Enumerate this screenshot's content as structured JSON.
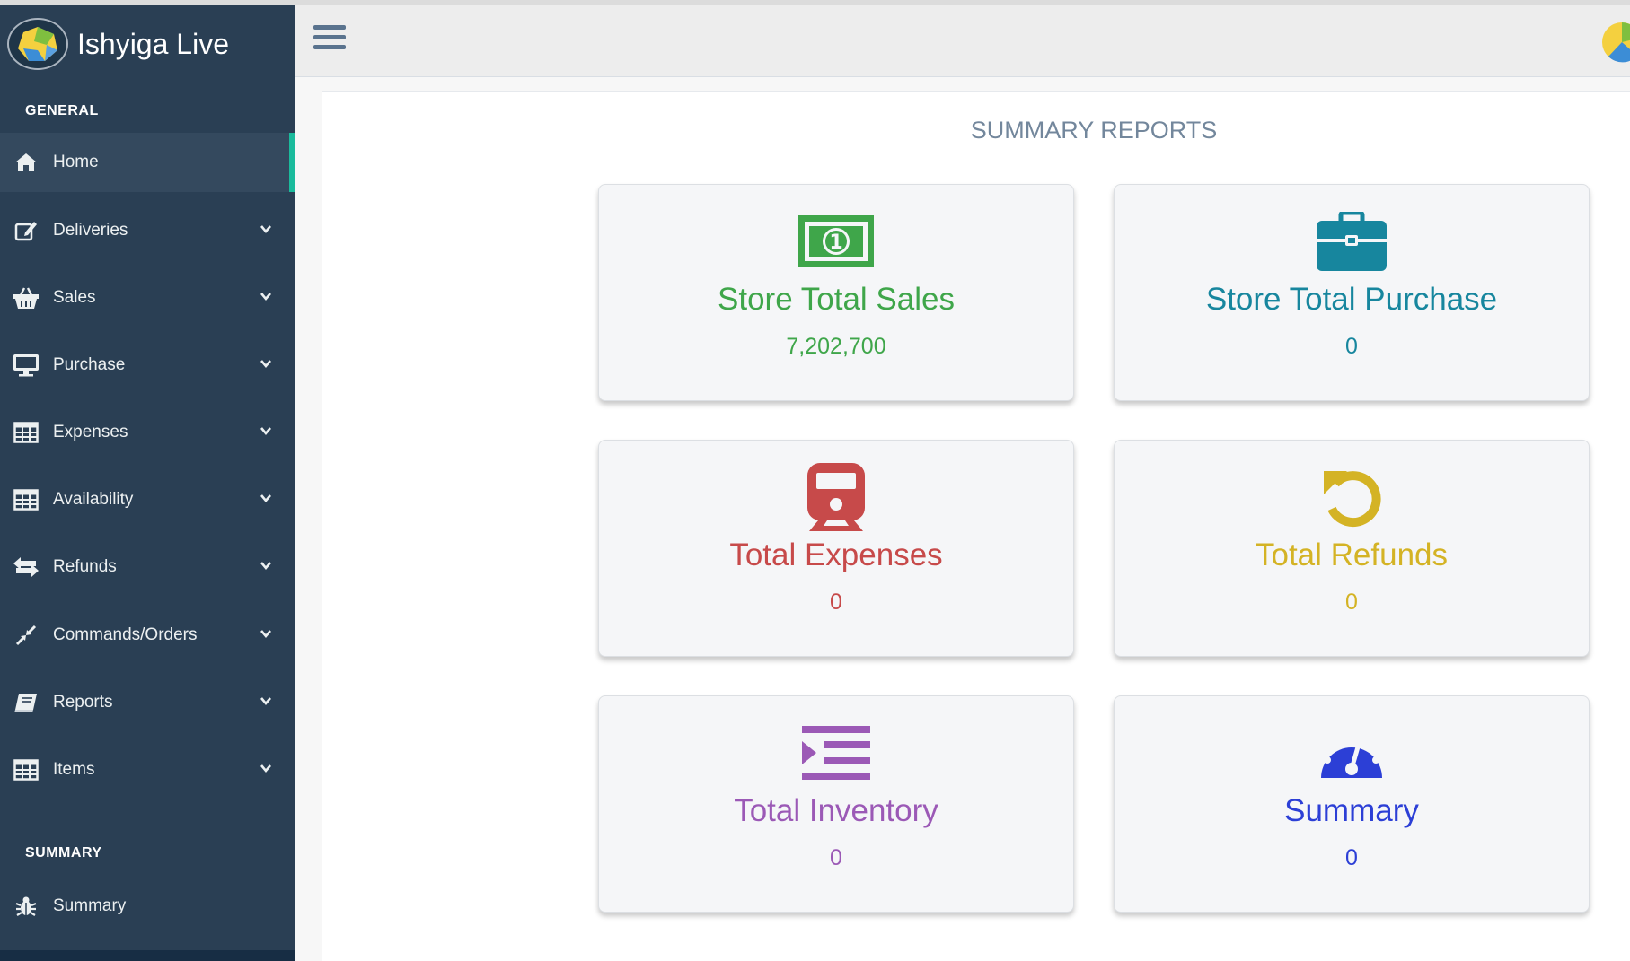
{
  "brand": {
    "title": "Ishyiga Live"
  },
  "sidebar": {
    "general_label": "GENERAL",
    "summary_label": "SUMMARY",
    "items": [
      {
        "label": "Home",
        "icon": "home-icon",
        "active": true,
        "has_chevron": false
      },
      {
        "label": "Deliveries",
        "icon": "edit-icon",
        "has_chevron": true
      },
      {
        "label": "Sales",
        "icon": "basket-icon",
        "has_chevron": true
      },
      {
        "label": "Purchase",
        "icon": "desktop-icon",
        "has_chevron": true
      },
      {
        "label": "Expenses",
        "icon": "table-icon",
        "has_chevron": true
      },
      {
        "label": "Availability",
        "icon": "table-icon",
        "has_chevron": true
      },
      {
        "label": "Refunds",
        "icon": "exchange-icon",
        "has_chevron": true
      },
      {
        "label": "Commands/Orders",
        "icon": "compress-icon",
        "has_chevron": true
      },
      {
        "label": "Reports",
        "icon": "book-icon",
        "has_chevron": true
      },
      {
        "label": "Items",
        "icon": "table-icon",
        "has_chevron": true
      }
    ],
    "summary_items": [
      {
        "label": "Summary",
        "icon": "bug-icon"
      }
    ]
  },
  "main": {
    "title": "SUMMARY REPORTS",
    "cards": [
      {
        "title": "Store Total Sales",
        "value": "7,202,700",
        "icon": "money-icon",
        "color": "#3fa64a"
      },
      {
        "title": "Store Total Purchase",
        "value": "0",
        "icon": "briefcase-icon",
        "color": "#17869e"
      },
      {
        "title": "Total Expenses",
        "value": "0",
        "icon": "train-icon",
        "color": "#c74a4a"
      },
      {
        "title": "Total Refunds",
        "value": "0",
        "icon": "undo-icon",
        "color": "#d4b325"
      },
      {
        "title": "Total Inventory",
        "value": "0",
        "icon": "indent-icon",
        "color": "#9b59b6"
      },
      {
        "title": "Summary",
        "value": "0",
        "icon": "dashboard-icon",
        "color": "#2c3fd6"
      }
    ]
  },
  "colors": {
    "sidebar_bg": "#2a3f54",
    "active_accent": "#1abb9c"
  }
}
